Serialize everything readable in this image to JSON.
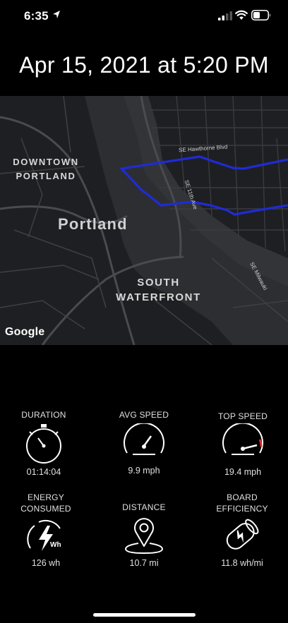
{
  "status_bar": {
    "time": "6:35"
  },
  "ride": {
    "title": "Apr 15, 2021 at 5:20 PM"
  },
  "map": {
    "labels": {
      "downtown": "DOWNTOWN PORTLAND",
      "city": "Portland",
      "waterfront": "SOUTH WATERFRONT"
    },
    "streets": {
      "hawthorne": "SE Hawthorne Blvd",
      "eleventh": "SE 11th Ave",
      "milwaukie": "SE Milwauki"
    },
    "attribution": "Google",
    "route_color": "#1f2bd6"
  },
  "stats": {
    "duration": {
      "label": "DURATION",
      "value": "01:14:04",
      "icon": "stopwatch-icon"
    },
    "avg_speed": {
      "label": "AVG SPEED",
      "value": "9.9 mph",
      "icon": "speedometer-icon"
    },
    "top_speed": {
      "label": "TOP SPEED",
      "value": "19.4 mph",
      "icon": "speedometer-max-icon"
    },
    "energy": {
      "label": "ENERGY CONSUMED",
      "value": "126 wh",
      "icon": "energy-bolt-icon"
    },
    "distance": {
      "label": "DISTANCE",
      "value": "10.7 mi",
      "icon": "map-pin-icon"
    },
    "efficiency": {
      "label": "BOARD EFFICIENCY",
      "value": "11.8 wh/mi",
      "icon": "battery-bolt-icon"
    }
  }
}
